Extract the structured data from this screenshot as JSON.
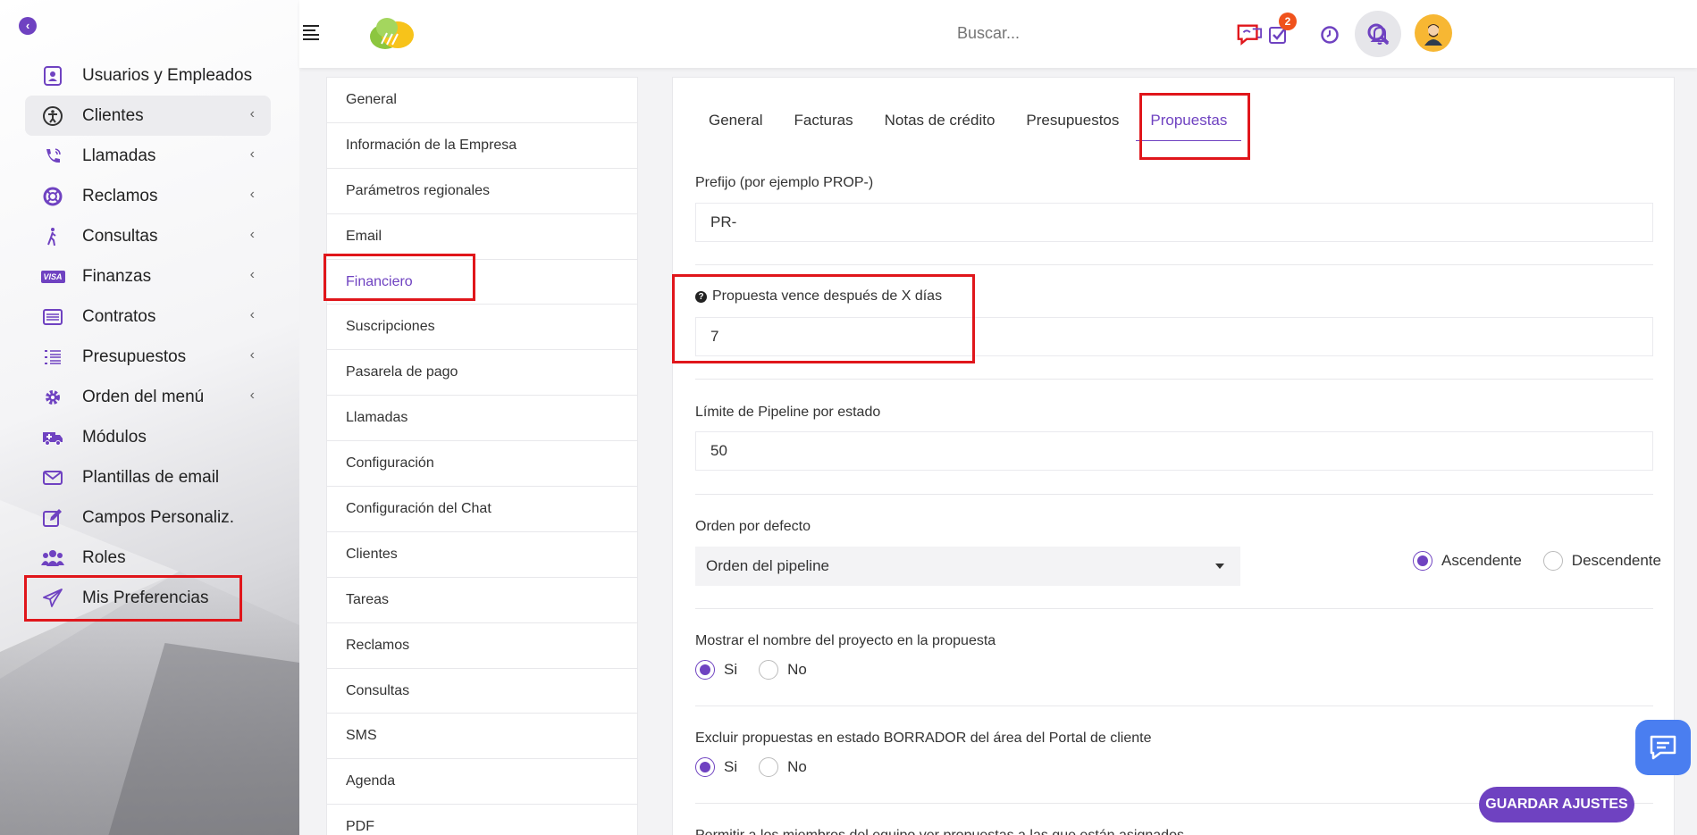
{
  "sidebar": {
    "items": [
      {
        "label": "Usuarios y Empleados",
        "icon": "user-badge-icon",
        "chevron": false
      },
      {
        "label": "Clientes",
        "icon": "accessibility-icon",
        "chevron": true
      },
      {
        "label": "Llamadas",
        "icon": "phone-call-icon",
        "chevron": true
      },
      {
        "label": "Reclamos",
        "icon": "lifebuoy-icon",
        "chevron": true
      },
      {
        "label": "Consultas",
        "icon": "walking-person-icon",
        "chevron": true
      },
      {
        "label": "Finanzas",
        "icon": "visa-card-icon",
        "chevron": true
      },
      {
        "label": "Contratos",
        "icon": "list-card-icon",
        "chevron": true
      },
      {
        "label": "Presupuestos",
        "icon": "numbered-list-icon",
        "chevron": true
      },
      {
        "label": "Orden del menú",
        "icon": "gear-icon",
        "chevron": true
      },
      {
        "label": "Módulos",
        "icon": "ambulance-icon",
        "chevron": false
      },
      {
        "label": "Plantillas de email",
        "icon": "envelope-icon",
        "chevron": false
      },
      {
        "label": "Campos Personaliz.",
        "icon": "edit-icon",
        "chevron": false
      },
      {
        "label": "Roles",
        "icon": "users-group-icon",
        "chevron": false
      },
      {
        "label": "Mis Preferencias",
        "icon": "paper-plane-icon",
        "chevron": false
      }
    ],
    "visa_text": "VISA"
  },
  "topbar": {
    "search_placeholder": "Buscar...",
    "task_badge": "2"
  },
  "settings_menu": {
    "items": [
      "General",
      "Información de la Empresa",
      "Parámetros regionales",
      "Email",
      "Financiero",
      "Suscripciones",
      "Pasarela de pago",
      "Llamadas",
      "Configuración",
      "Configuración del Chat",
      "Clientes",
      "Tareas",
      "Reclamos",
      "Consultas",
      "SMS",
      "Agenda",
      "PDF"
    ],
    "active": "Financiero"
  },
  "tabs": [
    "General",
    "Facturas",
    "Notas de crédito",
    "Presupuestos",
    "Propuestas"
  ],
  "form": {
    "prefix_label": "Prefijo (por ejemplo PROP-)",
    "prefix_value": "PR-",
    "expiry_label": "Propuesta vence después de X días",
    "expiry_value": "7",
    "pipeline_label": "Límite de Pipeline por estado",
    "pipeline_value": "50",
    "order_label": "Orden por defecto",
    "order_value": "Orden del pipeline",
    "asc_label": "Ascendente",
    "desc_label": "Descendente",
    "show_project_label": "Mostrar el nombre del proyecto en la propuesta",
    "exclude_draft_label": "Excluir propuestas en estado BORRADOR del área del Portal de cliente",
    "yes_label": "Si",
    "no_label": "No",
    "allow_members_label": "Permitir a los miembros del equipo ver propuestas a las que están asignados"
  },
  "save_label": "GUARDAR AJUSTES",
  "colors": {
    "accent": "#6f42c1",
    "highlight": "#e0161b",
    "badge": "#f0521c",
    "chat": "#4a7ef0"
  }
}
